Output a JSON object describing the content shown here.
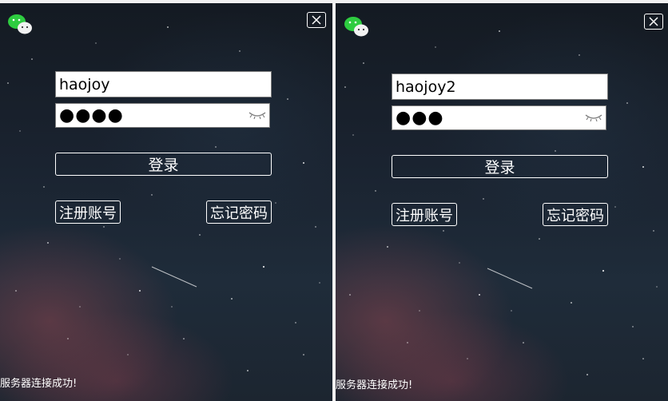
{
  "windows": [
    {
      "username": "haojoy",
      "password_mask": "●●●●",
      "login_label": "登录",
      "register_label": "注册账号",
      "forgot_label": "忘记密码",
      "status": "服务器连接成功!"
    },
    {
      "username": "haojoy2",
      "password_mask": "●●●",
      "login_label": "登录",
      "register_label": "注册账号",
      "forgot_label": "忘记密码",
      "status": "服务器连接成功!"
    }
  ],
  "icons": {
    "app_logo": "wechat-logo-icon",
    "close": "close-icon",
    "show_password": "eye-closed-icon"
  },
  "colors": {
    "logo_green": "#2ecc40",
    "border_white": "#ffffff",
    "input_bg": "#ffffff"
  }
}
